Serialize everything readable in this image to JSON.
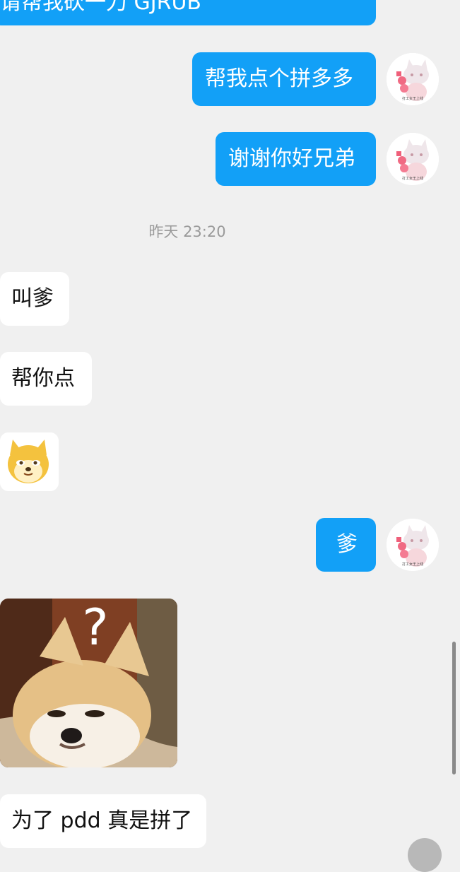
{
  "messages": {
    "top_partial": "请帮我砍一刀 GJRUB",
    "m1": "帮我点个拼多多",
    "m2": "谢谢你好兄弟",
    "timestamp": "昨天 23:20",
    "m3": "叫爹",
    "m4": "帮你点",
    "m5_sticker": "shiba-face-sticker",
    "m6": "爹",
    "m7_sticker": "shiba-question-sticker",
    "m8": "为了 pdd 真是拼了"
  },
  "avatar": {
    "caption": "打工女王上线"
  },
  "colors": {
    "background": "#f0f0f0",
    "outgoing_bubble": "#12a0f7",
    "incoming_bubble": "#ffffff"
  }
}
